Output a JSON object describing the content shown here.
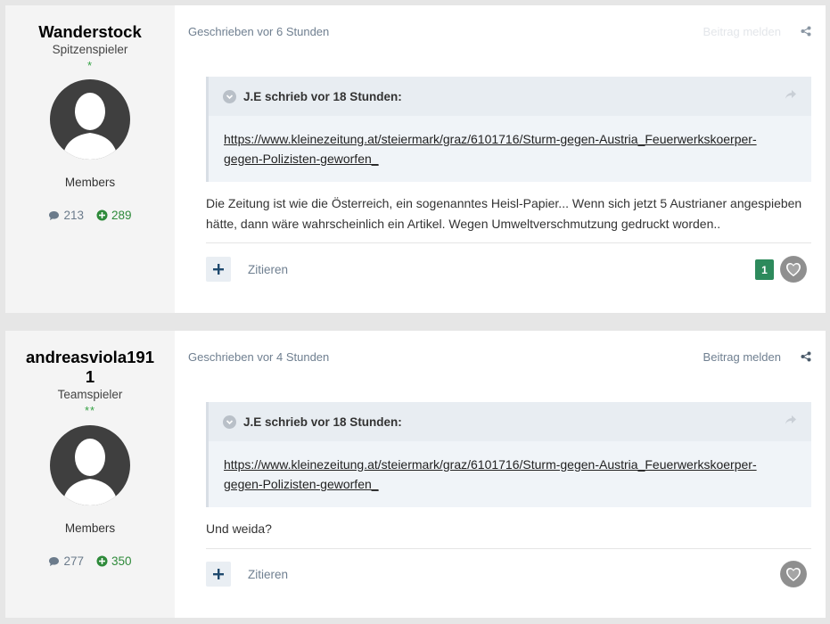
{
  "posts": [
    {
      "author": {
        "name": "Wanderstock",
        "title": "Spitzenspieler",
        "stars": "*",
        "group": "Members",
        "post_count": "213",
        "reputation": "289"
      },
      "meta": "Geschrieben vor 6 Stunden",
      "report_label": "Beitrag melden",
      "quote": {
        "header": "J.E schrieb vor 18 Stunden:",
        "link_line1": "https://www.kleinezeitung.at/steiermark/graz/6101716/Sturm-gegen-Austria_Feuerwerkskoerper-",
        "link_line2": "gegen-Polizisten-geworfen_"
      },
      "body_line1": "Die Zeitung ist wie die Österreich, ein sogenanntes Heisl-Papier... Wenn sich jetzt 5 Austrianer angespieben",
      "body_line2": "hätte, dann wäre wahrscheinlich ein Artikel. Wegen Umweltverschmutzung gedruckt worden..",
      "quote_label": "Zitieren",
      "like_count": "1"
    },
    {
      "author": {
        "name_line1": "andreasviola191",
        "name_line2": "1",
        "title": "Teamspieler",
        "stars": "**",
        "group": "Members",
        "post_count": "277",
        "reputation": "350"
      },
      "meta": "Geschrieben vor 4 Stunden",
      "report_label": "Beitrag melden",
      "quote": {
        "header": "J.E schrieb vor 18 Stunden:",
        "link_line1": "https://www.kleinezeitung.at/steiermark/graz/6101716/Sturm-gegen-Austria_Feuerwerkskoerper-",
        "link_line2": "gegen-Polizisten-geworfen_"
      },
      "body_line1": "Und weida?",
      "quote_label": "Zitieren"
    }
  ],
  "icons": {
    "posts": "speech-bubble-icon",
    "reputation": "plus-circle-icon",
    "share": "share-icon",
    "reply": "reply-arrow-icon",
    "collapse": "chevron-down-icon",
    "like": "heart-icon",
    "add": "plus-icon"
  },
  "colors": {
    "accent": "#2d8a5c",
    "reputation": "#2e8a3a",
    "stars": "#35a244",
    "link_muted": "#6f7f90"
  }
}
